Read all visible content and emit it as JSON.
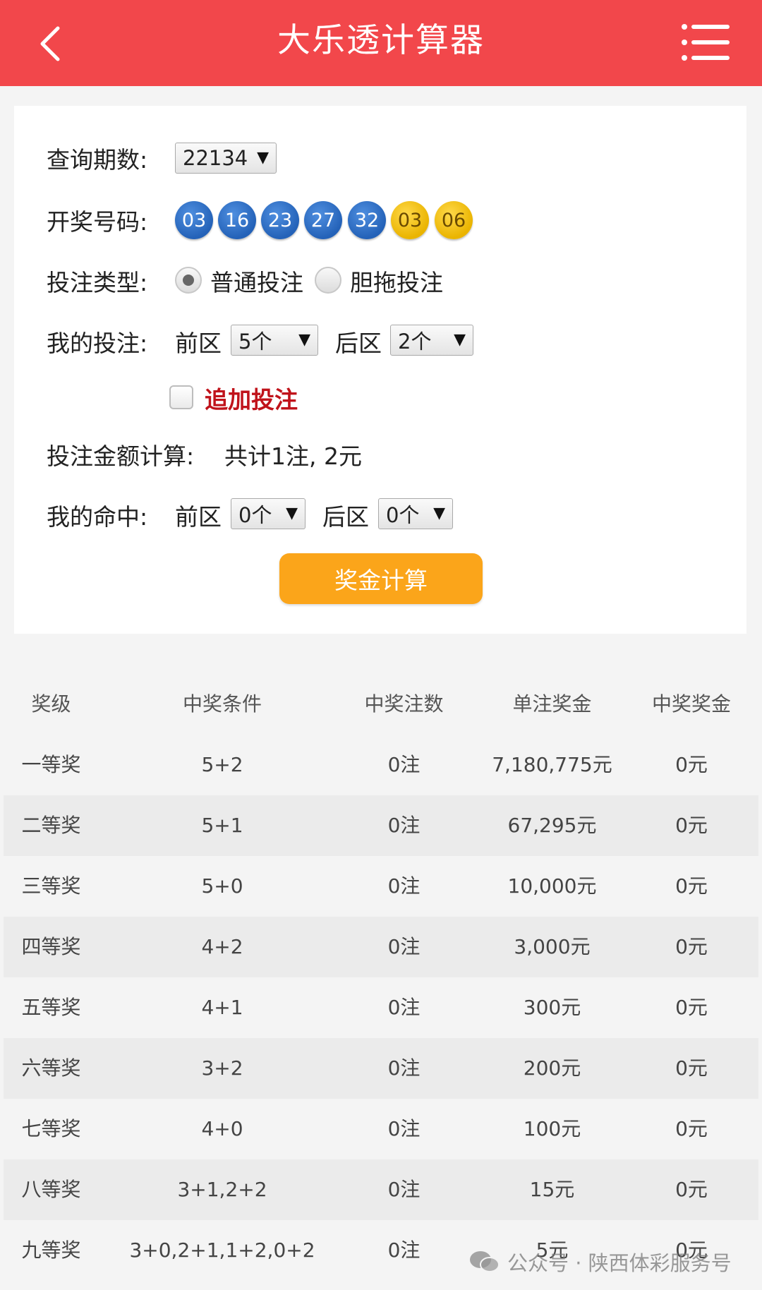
{
  "header": {
    "title": "大乐透计算器"
  },
  "form": {
    "period_label": "查询期数:",
    "period_value": "22134",
    "draw_label": "开奖号码:",
    "front_balls": [
      "03",
      "16",
      "23",
      "27",
      "32"
    ],
    "back_balls": [
      "03",
      "06"
    ],
    "bet_type_label": "投注类型:",
    "bet_type_options": [
      "普通投注",
      "胆拖投注"
    ],
    "bet_type_selected": "普通投注",
    "my_bet_label": "我的投注:",
    "front_zone_label": "前区",
    "back_zone_label": "后区",
    "my_bet_front_value": "5个",
    "my_bet_back_value": "2个",
    "add_bet_label": "追加投注",
    "add_bet_checked": false,
    "amount_label": "投注金额计算:",
    "amount_value": "共计1注, 2元",
    "my_hit_label": "我的命中:",
    "my_hit_front_value": "0个",
    "my_hit_back_value": "0个",
    "calc_button": "奖金计算"
  },
  "table": {
    "headers": [
      "奖级",
      "中奖条件",
      "中奖注数",
      "单注奖金",
      "中奖奖金"
    ],
    "rows": [
      [
        "一等奖",
        "5+2",
        "0注",
        "7,180,775元",
        "0元"
      ],
      [
        "二等奖",
        "5+1",
        "0注",
        "67,295元",
        "0元"
      ],
      [
        "三等奖",
        "5+0",
        "0注",
        "10,000元",
        "0元"
      ],
      [
        "四等奖",
        "4+2",
        "0注",
        "3,000元",
        "0元"
      ],
      [
        "五等奖",
        "4+1",
        "0注",
        "300元",
        "0元"
      ],
      [
        "六等奖",
        "3+2",
        "0注",
        "200元",
        "0元"
      ],
      [
        "七等奖",
        "4+0",
        "0注",
        "100元",
        "0元"
      ],
      [
        "八等奖",
        "3+1,2+2",
        "0注",
        "15元",
        "0元"
      ],
      [
        "九等奖",
        "3+0,2+1,1+2,0+2",
        "0注",
        "5元",
        "0元"
      ]
    ]
  },
  "watermark": "公众号 · 陕西体彩服务号",
  "colors": {
    "header_bg": "#f2474b",
    "button_bg": "#fba51a",
    "front_ball": "#2462b8",
    "back_ball": "#eab400",
    "add_bet_text": "#c0131b"
  }
}
